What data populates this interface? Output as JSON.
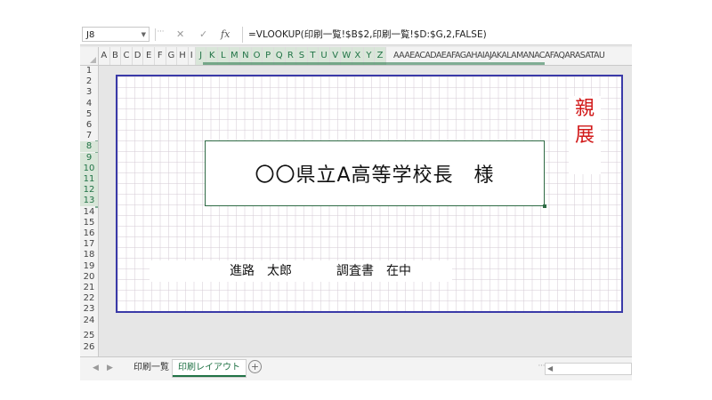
{
  "formula_bar": {
    "name_box": "J8",
    "cancel_icon": "✕",
    "enter_icon": "✓",
    "fx_label": "fx",
    "formula": "=VLOOKUP(印刷一覧!$B$2,印刷一覧!$D:$G,2,FALSE)"
  },
  "columns": [
    "A",
    "B",
    "C",
    "D",
    "E",
    "F",
    "G",
    "H",
    "I",
    "J",
    "K",
    "L",
    "M",
    "N",
    "O",
    "P",
    "Q",
    "R",
    "S",
    "T",
    "U",
    "V",
    "W",
    "X",
    "Y",
    "Z"
  ],
  "columns_overflow": "AAAEACADAEAFAGAHAIAJAKALAMANACAFAQARASATAU",
  "rows": [
    "1",
    "2",
    "3",
    "4",
    "5",
    "6",
    "7",
    "8",
    "9",
    "10",
    "11",
    "12",
    "13",
    "14",
    "15",
    "16",
    "17",
    "18",
    "19",
    "20",
    "21",
    "22",
    "23",
    "24",
    "25",
    "26"
  ],
  "page": {
    "title": "〇〇県立A高等学校長　様",
    "stamp_line1": "親",
    "stamp_line2": "展",
    "sender_name": "進路　太郎",
    "document": "調査書　在中"
  },
  "sheet_tabs": [
    {
      "label": "印刷一覧",
      "active": false
    },
    {
      "label": "印刷レイアウト",
      "active": true
    }
  ],
  "add_sheet": "⊕",
  "colors": {
    "selection": "#217346",
    "page_border": "#3a3aa8",
    "stamp": "#d11919"
  }
}
